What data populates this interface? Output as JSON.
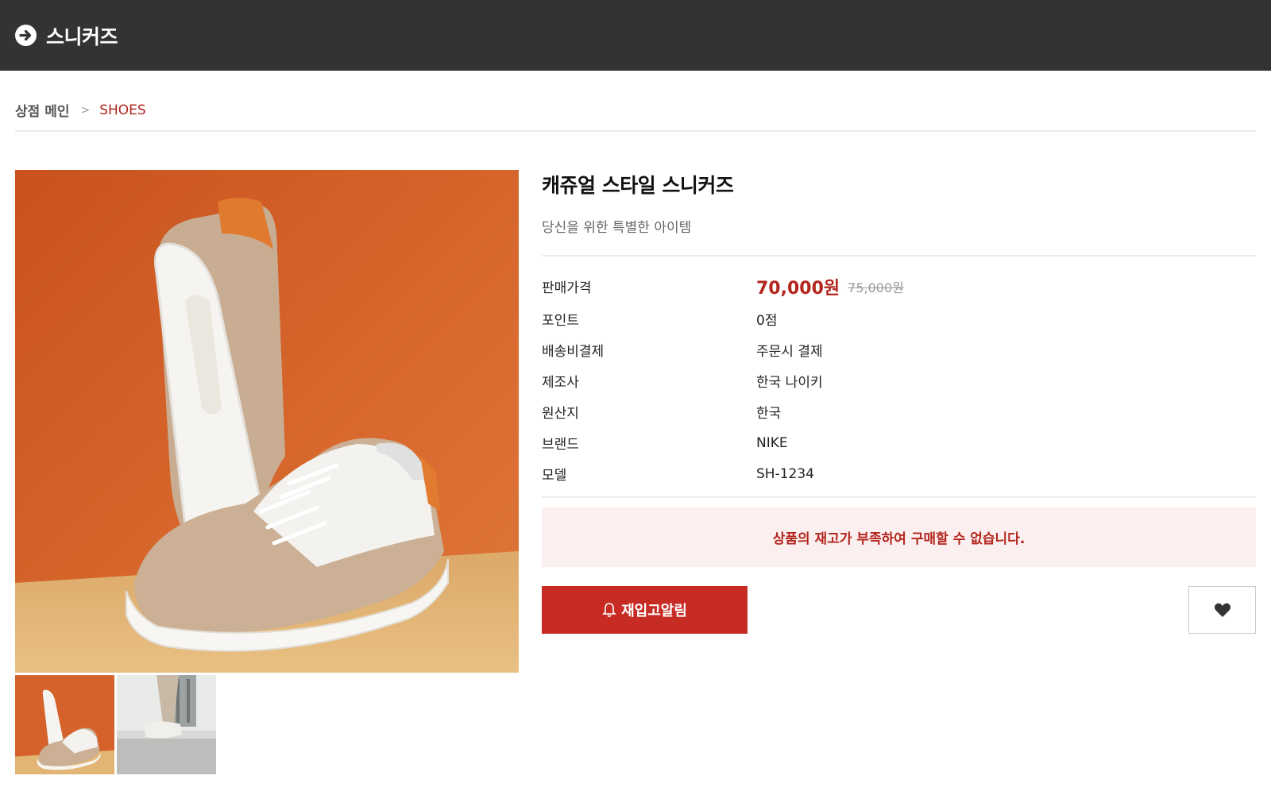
{
  "header": {
    "title": "스니커즈",
    "back_icon": "arrow-circle-right-icon"
  },
  "breadcrumb": {
    "home": "상점 메인",
    "separator": ">",
    "current": "SHOES"
  },
  "product": {
    "name": "캐쥬얼 스타일 스니커즈",
    "description": "당신을 위한 특별한 아이템",
    "specs": [
      {
        "label": "판매가격",
        "sale_price": "70,000원",
        "original_price": "75,000원"
      },
      {
        "label": "포인트",
        "value": "0점"
      },
      {
        "label": "배송비결제",
        "value": "주문시 결제"
      },
      {
        "label": "제조사",
        "value": "한국 나이키"
      },
      {
        "label": "원산지",
        "value": "한국"
      },
      {
        "label": "브랜드",
        "value": "NIKE"
      },
      {
        "label": "모델",
        "value": "SH-1234"
      }
    ],
    "soldout_message": "상품의 재고가 부족하여 구매할 수 없습니다.",
    "restock_button": "재입고알림",
    "thumbnail_count": 2
  },
  "colors": {
    "accent": "#b3261e",
    "button": "#c62c24",
    "header_bg": "#333333",
    "notice_bg": "#fcefef"
  }
}
